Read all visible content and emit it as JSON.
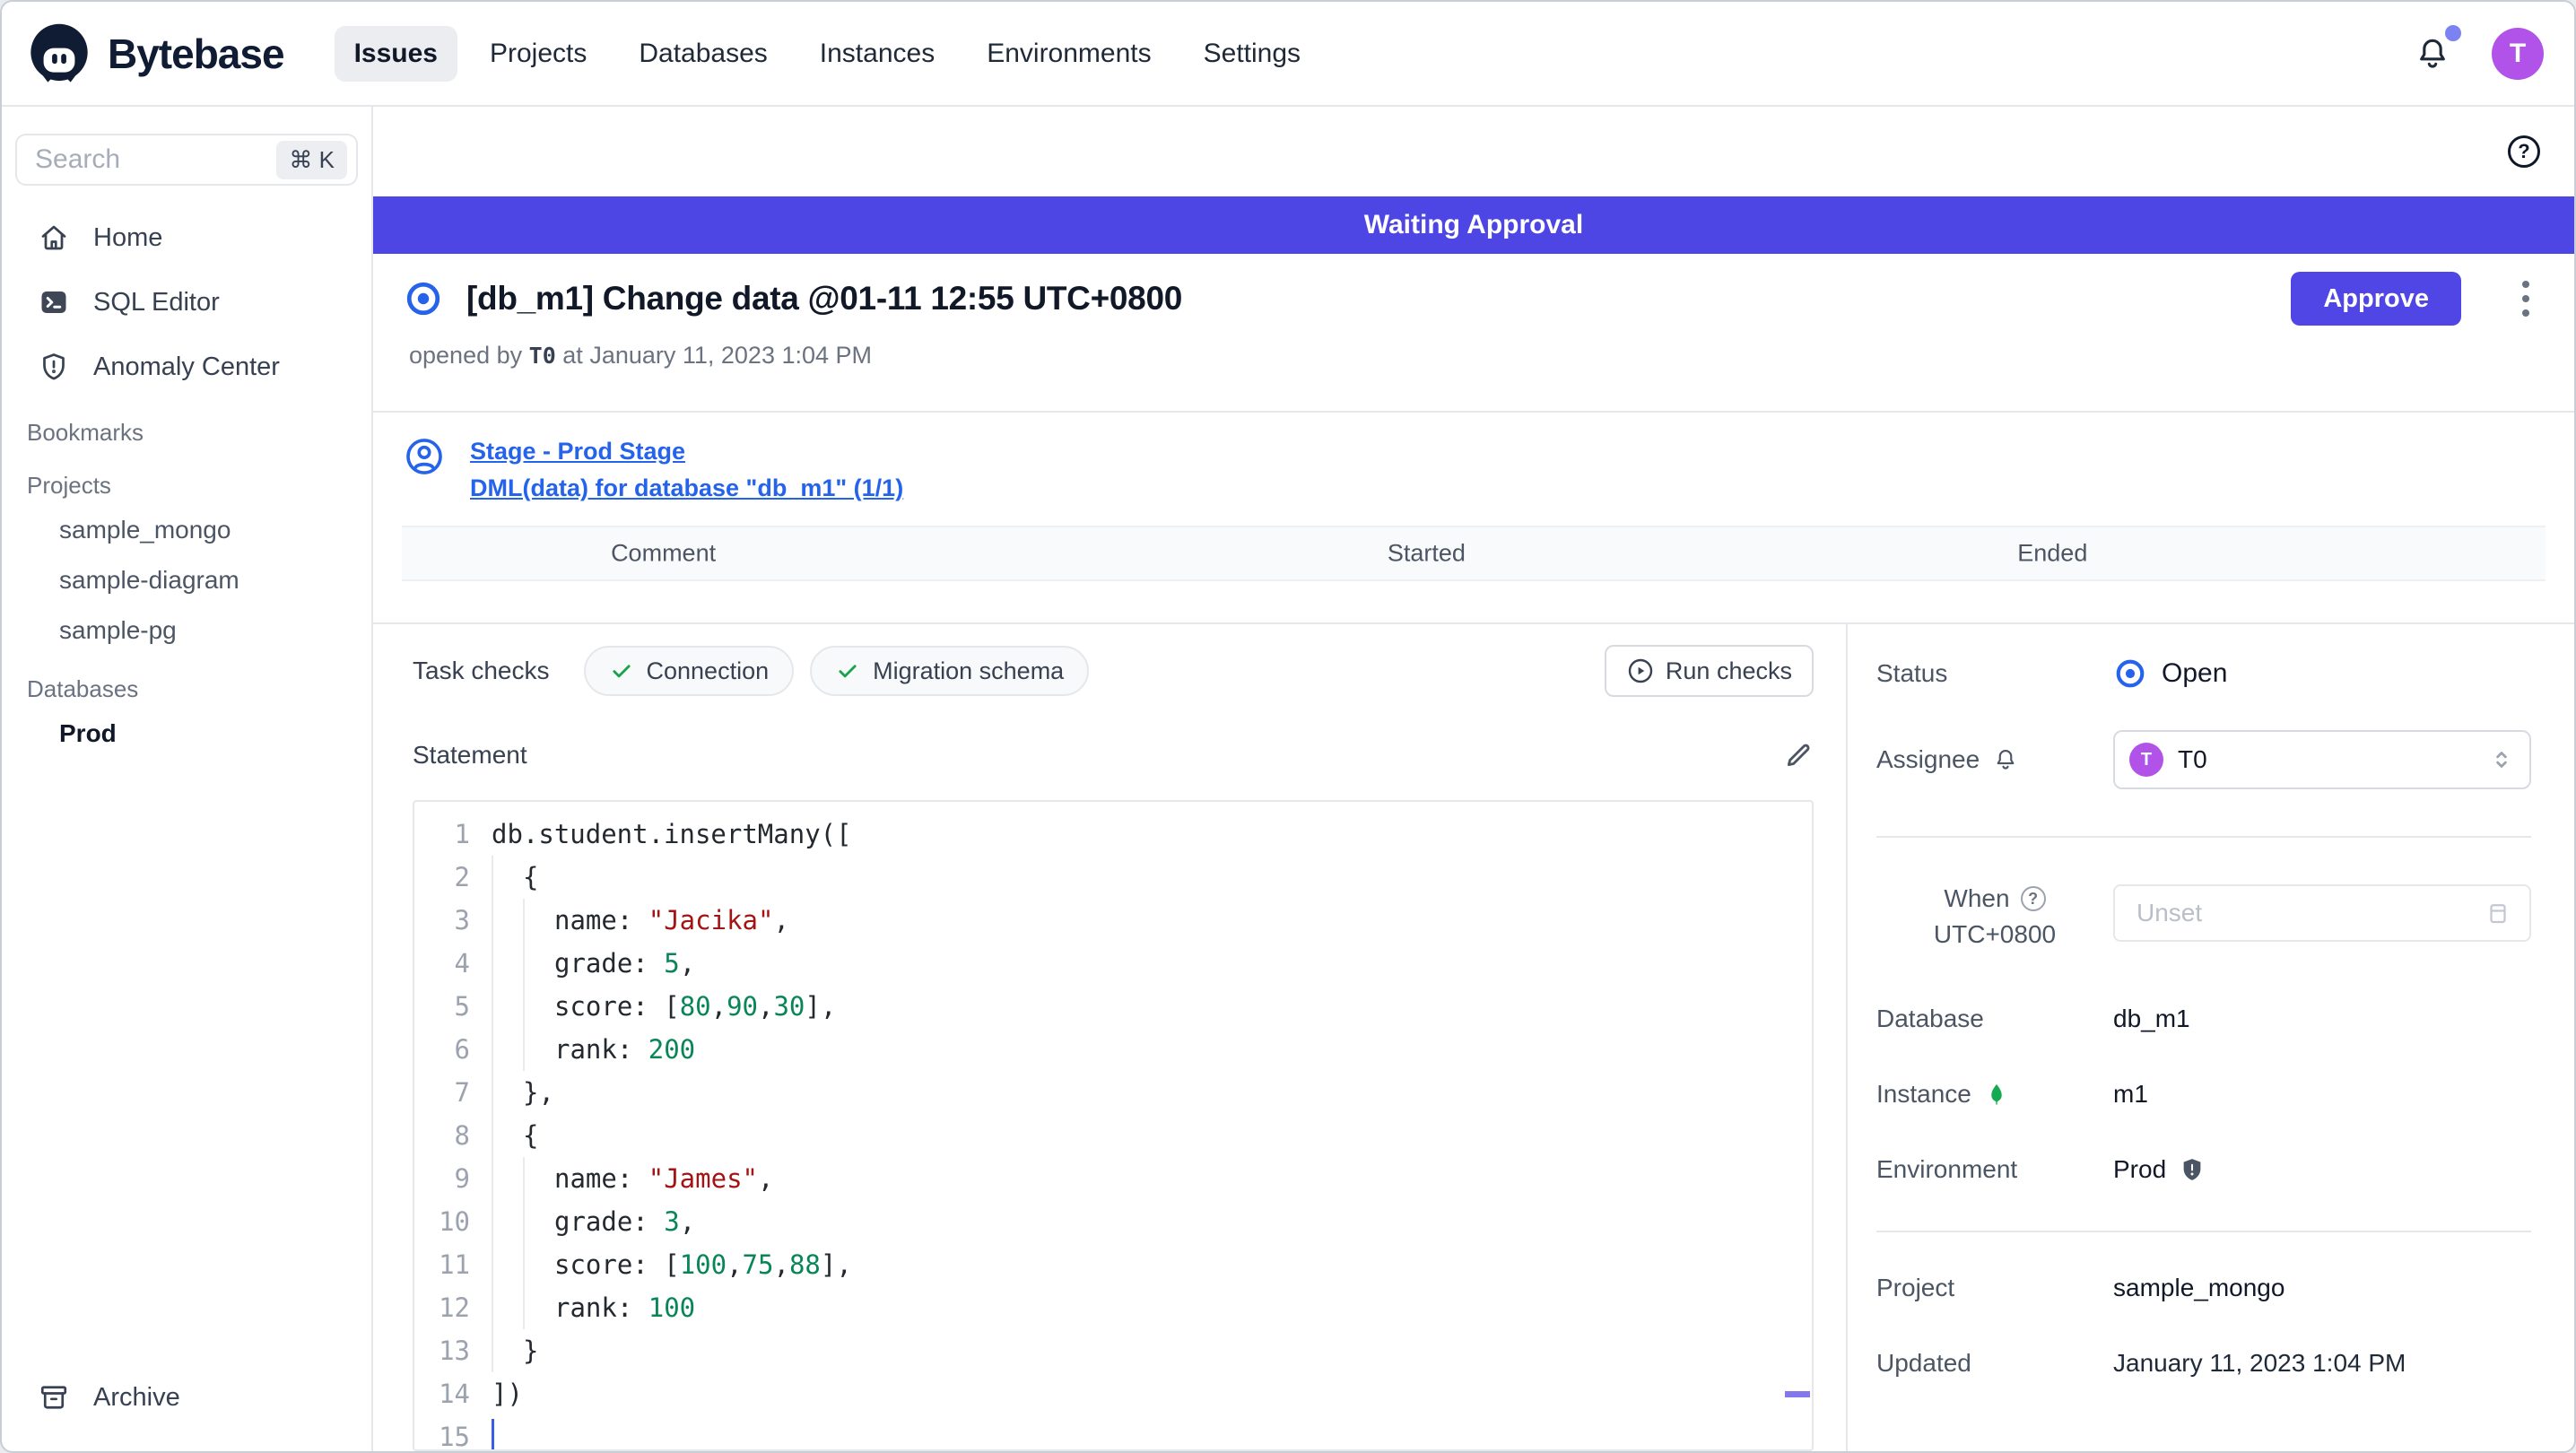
{
  "header": {
    "brand": "Bytebase",
    "nav": [
      {
        "label": "Issues",
        "active": true
      },
      {
        "label": "Projects",
        "active": false
      },
      {
        "label": "Databases",
        "active": false
      },
      {
        "label": "Instances",
        "active": false
      },
      {
        "label": "Environments",
        "active": false
      },
      {
        "label": "Settings",
        "active": false
      }
    ],
    "avatar_initial": "T"
  },
  "sidebar": {
    "search_placeholder": "Search",
    "shortcut": "⌘ K",
    "items": [
      {
        "label": "Home",
        "icon": "home"
      },
      {
        "label": "SQL Editor",
        "icon": "terminal"
      },
      {
        "label": "Anomaly Center",
        "icon": "shield-alert"
      }
    ],
    "sections": [
      {
        "title": "Bookmarks",
        "items": []
      },
      {
        "title": "Projects",
        "items": [
          {
            "label": "sample_mongo",
            "bold": false
          },
          {
            "label": "sample-diagram",
            "bold": false
          },
          {
            "label": "sample-pg",
            "bold": false
          }
        ]
      },
      {
        "title": "Databases",
        "items": [
          {
            "label": "Prod",
            "bold": true
          }
        ]
      }
    ],
    "archive_label": "Archive"
  },
  "banner": {
    "text": "Waiting Approval"
  },
  "issue": {
    "title": "[db_m1] Change data @01-11 12:55 UTC+0800",
    "opened_by_prefix": "opened by",
    "author": "T0",
    "opened_at_join": "at",
    "opened_at": "January 11, 2023 1:04 PM",
    "approve_label": "Approve"
  },
  "stage": {
    "link1": "Stage - Prod Stage",
    "link2": "DML(data) for database \"db_m1\" (1/1)"
  },
  "history_table": {
    "columns": [
      "Comment",
      "Started",
      "Ended"
    ]
  },
  "task_checks": {
    "label": "Task checks",
    "checks": [
      "Connection",
      "Migration schema"
    ],
    "run_button": "Run checks"
  },
  "statement": {
    "label": "Statement"
  },
  "code": {
    "language": "mongodb-javascript",
    "lines": [
      {
        "n": 1,
        "indent": 0,
        "tokens": [
          [
            "p",
            "db.student.insertMany(["
          ]
        ]
      },
      {
        "n": 2,
        "indent": 1,
        "tokens": [
          [
            "p",
            "{"
          ]
        ]
      },
      {
        "n": 3,
        "indent": 2,
        "tokens": [
          [
            "p",
            "name: "
          ],
          [
            "s",
            "\"Jacika\""
          ],
          [
            "p",
            ","
          ]
        ]
      },
      {
        "n": 4,
        "indent": 2,
        "tokens": [
          [
            "p",
            "grade: "
          ],
          [
            "n",
            "5"
          ],
          [
            "p",
            ","
          ]
        ]
      },
      {
        "n": 5,
        "indent": 2,
        "tokens": [
          [
            "p",
            "score: ["
          ],
          [
            "n",
            "80"
          ],
          [
            "p",
            ","
          ],
          [
            "n",
            "90"
          ],
          [
            "p",
            ","
          ],
          [
            "n",
            "30"
          ],
          [
            "p",
            "],"
          ]
        ]
      },
      {
        "n": 6,
        "indent": 2,
        "tokens": [
          [
            "p",
            "rank: "
          ],
          [
            "n",
            "200"
          ]
        ]
      },
      {
        "n": 7,
        "indent": 1,
        "tokens": [
          [
            "p",
            "},"
          ]
        ]
      },
      {
        "n": 8,
        "indent": 1,
        "tokens": [
          [
            "p",
            "{"
          ]
        ]
      },
      {
        "n": 9,
        "indent": 2,
        "tokens": [
          [
            "p",
            "name: "
          ],
          [
            "s",
            "\"James\""
          ],
          [
            "p",
            ","
          ]
        ]
      },
      {
        "n": 10,
        "indent": 2,
        "tokens": [
          [
            "p",
            "grade: "
          ],
          [
            "n",
            "3"
          ],
          [
            "p",
            ","
          ]
        ]
      },
      {
        "n": 11,
        "indent": 2,
        "tokens": [
          [
            "p",
            "score: ["
          ],
          [
            "n",
            "100"
          ],
          [
            "p",
            ","
          ],
          [
            "n",
            "75"
          ],
          [
            "p",
            ","
          ],
          [
            "n",
            "88"
          ],
          [
            "p",
            "],"
          ]
        ]
      },
      {
        "n": 12,
        "indent": 2,
        "tokens": [
          [
            "p",
            "rank: "
          ],
          [
            "n",
            "100"
          ]
        ]
      },
      {
        "n": 13,
        "indent": 1,
        "tokens": [
          [
            "p",
            "}"
          ]
        ]
      },
      {
        "n": 14,
        "indent": 0,
        "tokens": [
          [
            "p",
            "])"
          ]
        ]
      },
      {
        "n": 15,
        "indent": 0,
        "tokens": [],
        "caret": true
      }
    ]
  },
  "aside": {
    "status_label": "Status",
    "status_value": "Open",
    "assignee_label": "Assignee",
    "assignee_value": "T0",
    "assignee_avatar": "T",
    "when_label": "When",
    "timezone": "UTC+0800",
    "when_placeholder": "Unset",
    "database_label": "Database",
    "database_value": "db_m1",
    "instance_label": "Instance",
    "instance_value": "m1",
    "environment_label": "Environment",
    "environment_value": "Prod",
    "project_label": "Project",
    "project_value": "sample_mongo",
    "updated_label": "Updated",
    "updated_value": "January 11, 2023 1:04 PM"
  },
  "colors": {
    "banner_indigo": "#4d45e4",
    "approve_indigo": "#4f46e5",
    "link_blue": "#2563eb",
    "open_status_blue": "#2563eb",
    "success_green": "#16a34a",
    "avatar_purple": "#b153e8",
    "notification_dot": "#7b82f2",
    "mongo_green": "#13aa52",
    "code_string_red": "#a31515",
    "code_number_green": "#098658"
  }
}
